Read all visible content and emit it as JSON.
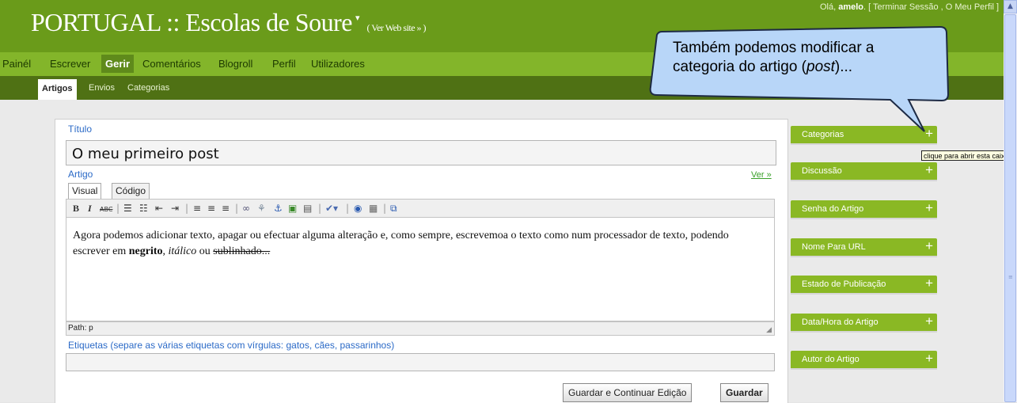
{
  "header": {
    "site_title": "PORTUGAL :: Escolas de Soure",
    "view_site": "( Ver Web site » )",
    "user_greeting": "Olá, ",
    "user_name": "amelo",
    "user_links": ". [ Terminar Sessão , O Meu Perfil ]"
  },
  "menu": [
    "Painél",
    "Escrever",
    "Gerir",
    "Comentários",
    "Blogroll",
    "Perfil",
    "Utilizadores"
  ],
  "submenu": [
    "Artigos",
    "Envios",
    "Categorias"
  ],
  "form": {
    "title_label": "Título",
    "title_value": "O meu primeiro post",
    "article_label": "Artigo",
    "view_link": "Ver »",
    "tab_visual": "Visual",
    "tab_code": "Código",
    "body_text_a": "Agora podemos adicionar texto, apagar ou efectuar alguma alteração e, como sempre, escrevemoa o texto como num processador de texto, podendo escrever em ",
    "body_bold": "negrito",
    "body_sep": ", ",
    "body_italic": "itálico",
    "body_or": " ou ",
    "body_strike": "sublinhado...",
    "path_label": "Path: p",
    "tags_label": "Etiquetas (separe as várias etiquetas com vírgulas: gatos, cães, passarinhos)",
    "tags_value": "",
    "save_continue": "Guardar e Continuar Edição",
    "save": "Guardar"
  },
  "sidebar_boxes": [
    "Categorias",
    "Discussão",
    "Senha do Artigo",
    "Nome Para URL",
    "Estado de Publicação",
    "Data/Hora do Artigo",
    "Autor do Artigo"
  ],
  "tooltip": "clique para abrir esta caixa",
  "callout": {
    "line1": "Também podemos modificar a",
    "line2a": "categoria do artigo (",
    "line2b": "post",
    "line2c": ")..."
  },
  "colors": {
    "header": "#6a9b1a",
    "menu": "#83b52a",
    "submenu": "#4f7114",
    "box": "#8ab824",
    "callout": "#b5d5f9"
  }
}
